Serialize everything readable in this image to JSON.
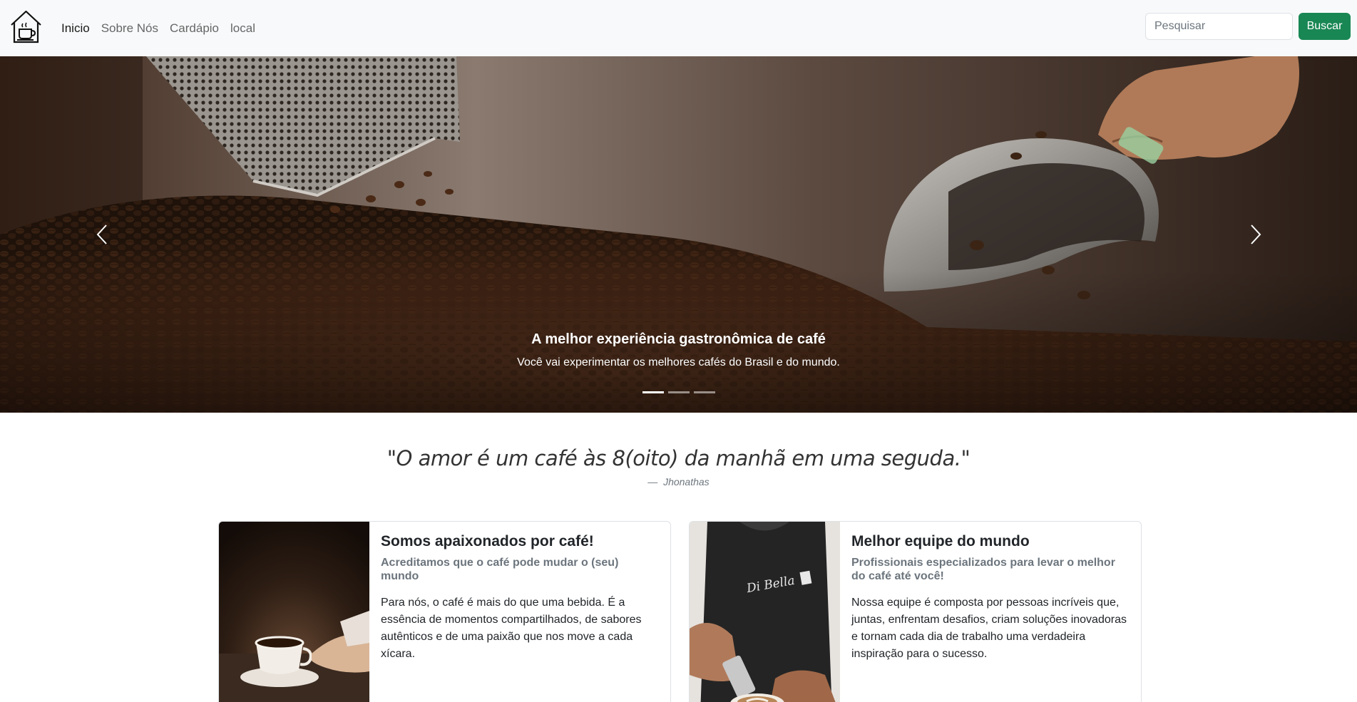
{
  "nav": {
    "links": [
      "Inicio",
      "Sobre Nós",
      "Cardápio",
      "local"
    ],
    "search_placeholder": "Pesquisar",
    "search_button": "Buscar"
  },
  "hero": {
    "title": "A melhor experiência gastronômica de café",
    "subtitle": "Você vai experimentar os melhores cafés do Brasil e do mundo.",
    "slides_count": 3,
    "active_slide": 1
  },
  "quote": {
    "text": "\"O amor é um café às 8(oito) da manhã em uma seguda.\"",
    "author": "Jhonathas"
  },
  "cards": [
    {
      "title": "Somos apaixonados por café!",
      "subtitle": "Acreditamos que o café pode mudar o (seu) mundo",
      "text": "Para nós, o café é mais do que uma bebida. É a essência de momentos compartilhados, de sabores autênticos e de uma paixão que nos move a cada xícara."
    },
    {
      "title": "Melhor equipe do mundo",
      "subtitle": "Profissionais especializados para levar o melhor do café até você!",
      "text": "Nossa equipe é composta por pessoas incríveis que, juntas, enfrentam desafios, criam soluções inovadoras e tornam cada dia de trabalho uma verdadeira inspiração para o sucesso.",
      "apron_text": "Di Bella"
    }
  ],
  "colors": {
    "navbar_bg": "#f8f9fa",
    "success": "#198754"
  }
}
